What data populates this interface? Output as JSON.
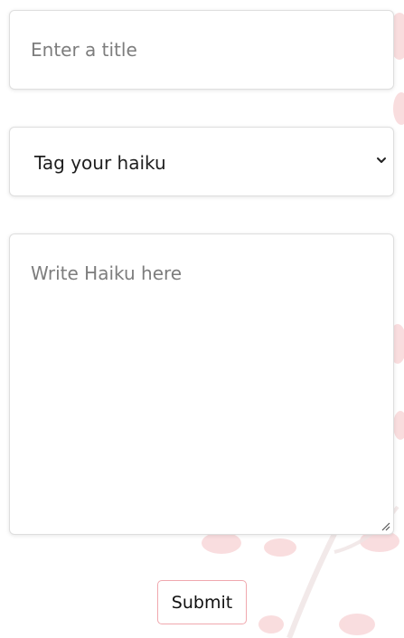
{
  "form": {
    "title_placeholder": "Enter a title",
    "tag_select_value": "Tag your haiku",
    "haiku_placeholder": "Write Haiku here",
    "submit_label": "Submit"
  },
  "theme": {
    "background": "#ffffff",
    "field_border": "#dedede",
    "placeholder_color": "#7d7d7d",
    "submit_border": "#f0a8ae",
    "blossom_color": "#f6c9cc"
  },
  "icons": {
    "select_arrow": "chevron-down-icon",
    "resize_handle": "resize-grip-icon",
    "background": "cherry-blossom-decoration"
  }
}
